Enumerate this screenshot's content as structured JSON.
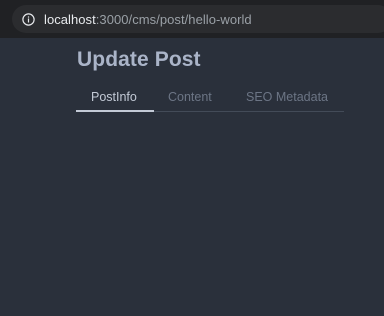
{
  "browser": {
    "url_host": "localhost",
    "url_rest": ":3000/cms/post/hello-world"
  },
  "page": {
    "title": "Update Post",
    "tabs": [
      {
        "label": "PostInfo",
        "active": true
      },
      {
        "label": "Content",
        "active": false
      },
      {
        "label": "SEO Metadata",
        "active": false
      }
    ]
  },
  "colors": {
    "background": "#2a303b",
    "title": "#aab4c8",
    "tab_active": "#c3cad6",
    "tab_inactive": "#6c7585"
  }
}
